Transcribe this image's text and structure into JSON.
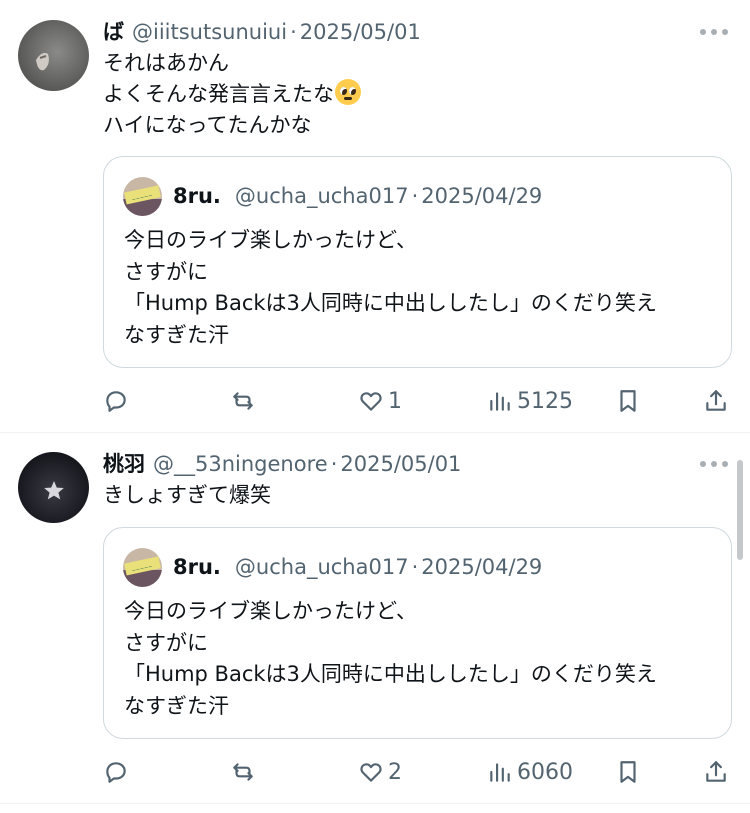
{
  "posts": [
    {
      "name": "ば",
      "handle": "@iiitsutsunuiui",
      "separator": "·",
      "date": "2025/05/01",
      "lines": [
        "それはあかん",
        "よくそんな発言言えたな",
        "ハイになってたんかな"
      ],
      "emoji": "pleading-face-emoji",
      "quote": {
        "name": "8ru.",
        "handle": "@ucha_ucha017",
        "separator": "·",
        "date": "2025/04/29",
        "lines": [
          "今日のライブ楽しかったけど、",
          "さすがに",
          "「Hump Backは3人同時に中出ししたし」のくだり笑え",
          "なすぎた汗"
        ]
      },
      "stats": {
        "replies": "",
        "reposts": "",
        "likes": "1",
        "views": "5125"
      }
    },
    {
      "name": "桃羽",
      "handle": "@__53ningenore",
      "separator": "·",
      "date": "2025/05/01",
      "lines": [
        "きしょすぎて爆笑"
      ],
      "quote": {
        "name": "8ru.",
        "handle": "@ucha_ucha017",
        "separator": "·",
        "date": "2025/04/29",
        "lines": [
          "今日のライブ楽しかったけど、",
          "さすがに",
          "「Hump Backは3人同時に中出ししたし」のくだり笑え",
          "なすぎた汗"
        ]
      },
      "stats": {
        "replies": "",
        "reposts": "",
        "likes": "2",
        "views": "6060"
      }
    }
  ],
  "icons": {
    "reply": "reply-icon",
    "repost": "repost-icon",
    "like": "heart-icon",
    "views": "views-chart-icon",
    "bookmark": "bookmark-icon",
    "share": "share-icon",
    "more": "more-icon"
  },
  "colors": {
    "text": "#0f1419",
    "secondary": "#536471",
    "border": "#cfd9de",
    "divider": "#eff3f4"
  }
}
